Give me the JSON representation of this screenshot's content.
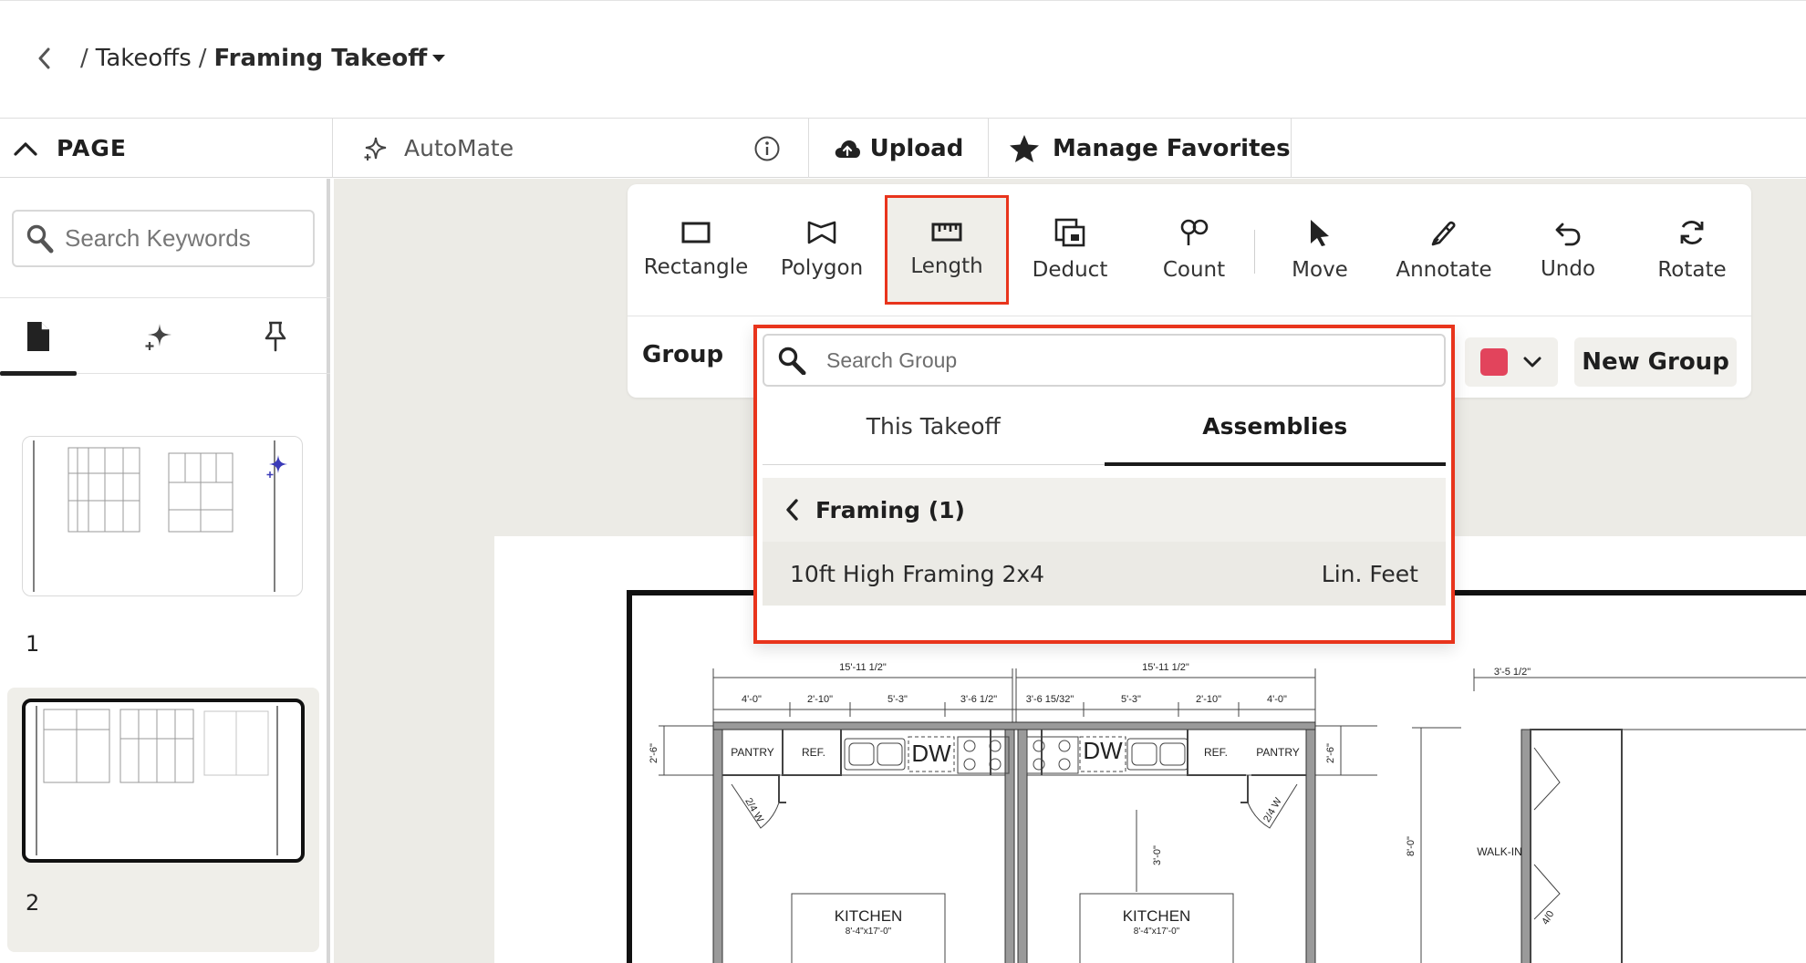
{
  "breadcrumb": {
    "separator": "/",
    "parent": "Takeoffs",
    "current": "Framing Takeoff"
  },
  "toolbar": {
    "page_label": "PAGE",
    "automate_label": "AutoMate",
    "upload_label": "Upload",
    "favorites_label": "Manage Favorites"
  },
  "sidebar": {
    "search_placeholder": "Search Keywords",
    "tabs": [
      {
        "icon": "document-icon",
        "active": true
      },
      {
        "icon": "sparkle-icon",
        "active": false
      },
      {
        "icon": "pin-icon",
        "active": false
      }
    ],
    "pages": [
      {
        "number": "1",
        "selected": false
      },
      {
        "number": "2",
        "selected": true
      }
    ]
  },
  "tools": {
    "items": [
      {
        "label": "Rectangle",
        "icon": "rectangle-icon"
      },
      {
        "label": "Polygon",
        "icon": "polygon-icon"
      },
      {
        "label": "Length",
        "icon": "ruler-icon",
        "selected": true
      },
      {
        "label": "Deduct",
        "icon": "deduct-icon"
      },
      {
        "label": "Count",
        "icon": "count-icon"
      },
      {
        "label": "Move",
        "icon": "cursor-arrow-icon"
      },
      {
        "label": "Annotate",
        "icon": "pen-icon"
      },
      {
        "label": "Undo",
        "icon": "undo-icon"
      },
      {
        "label": "Rotate",
        "icon": "rotate-icon"
      }
    ]
  },
  "group": {
    "label": "Group",
    "search_placeholder": "Search Group",
    "color": "#e2445c",
    "new_group_label": "New Group"
  },
  "dropdown": {
    "tabs": [
      "This Takeoff",
      "Assemblies"
    ],
    "active_tab": "Assemblies",
    "section": "Framing (1)",
    "items": [
      {
        "name": "10ft High Framing 2x4",
        "unit": "Lin. Feet"
      }
    ]
  },
  "plan": {
    "dims_top": [
      "15'-11 1/2\"",
      "15'-11 1/2\"",
      "3'-5 1/2\""
    ],
    "dims_second": [
      "4'-0\"",
      "2'-10\"",
      "5'-3\"",
      "3'-6 1/2\"",
      "3'-6 15/32\"",
      "5'-3\"",
      "2'-10\"",
      "4'-0\""
    ],
    "side_dims": [
      "2'-6\"",
      "2'-6\"",
      "8'-0\"",
      "3'-0\""
    ],
    "labels": [
      "PANTRY",
      "REF.",
      "DW",
      "DW",
      "REF.",
      "PANTRY",
      "2/4 W",
      "2/4 W",
      "WALK-IN",
      "4/0"
    ],
    "kitchen_label": "KITCHEN",
    "kitchen_dims": "8'-4\"x17'-0\""
  },
  "accent_color": "#e8341c"
}
